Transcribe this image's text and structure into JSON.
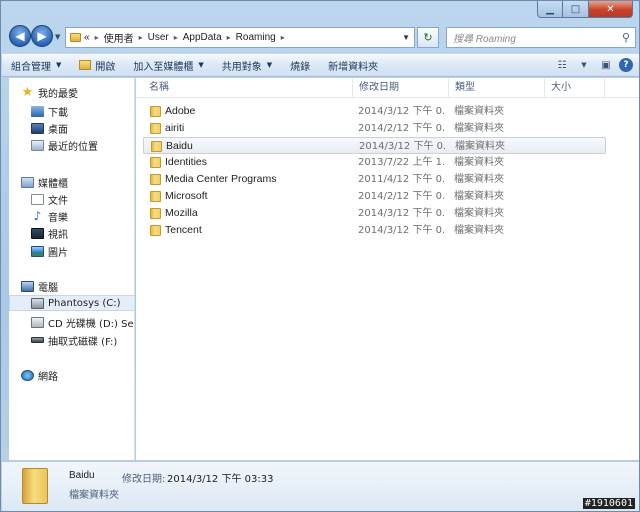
{
  "window": {
    "controls": {
      "minimize": "▁",
      "maximize": "□",
      "close": "✕"
    }
  },
  "navigation": {
    "breadcrumbs": [
      "«",
      "使用者",
      "User",
      "AppData",
      "Roaming"
    ],
    "search_placeholder": "搜尋 Roaming"
  },
  "toolbar": {
    "organize": "組合管理",
    "open": "開啟",
    "include_in_library": "加入至媒體櫃",
    "share_with": "共用對象",
    "burn": "燒錄",
    "new_folder": "新增資料夾"
  },
  "sidebar": {
    "favorites": "我的最愛",
    "downloads": "下載",
    "desktop": "桌面",
    "recent": "最近的位置",
    "libraries": "媒體櫃",
    "documents": "文件",
    "music": "音樂",
    "videos": "視訊",
    "pictures": "圖片",
    "computer": "電腦",
    "drive_c": "Phantosys (C:)",
    "drive_d": "CD 光碟機 (D:) Secu",
    "drive_f": "抽取式磁碟 (F:)",
    "network": "網路"
  },
  "columns": {
    "name": "名稱",
    "date": "修改日期",
    "type": "類型",
    "size": "大小"
  },
  "files": [
    {
      "name": "Adobe",
      "date": "2014/3/12 下午 0...",
      "type": "檔案資料夾"
    },
    {
      "name": "airiti",
      "date": "2014/2/12 下午 0...",
      "type": "檔案資料夾"
    },
    {
      "name": "Baidu",
      "date": "2014/3/12 下午 0...",
      "type": "檔案資料夾"
    },
    {
      "name": "Identities",
      "date": "2013/7/22 上午 1...",
      "type": "檔案資料夾"
    },
    {
      "name": "Media Center Programs",
      "date": "2011/4/12 下午 0...",
      "type": "檔案資料夾"
    },
    {
      "name": "Microsoft",
      "date": "2014/2/12 下午 0...",
      "type": "檔案資料夾"
    },
    {
      "name": "Mozilla",
      "date": "2014/3/12 下午 0...",
      "type": "檔案資料夾"
    },
    {
      "name": "Tencent",
      "date": "2014/3/12 下午 0...",
      "type": "檔案資料夾"
    }
  ],
  "details": {
    "name": "Baidu",
    "type": "檔案資料夾",
    "modified_label": "修改日期:",
    "modified_value": "2014/3/12 下午 03:33"
  },
  "watermark": "#1910601"
}
